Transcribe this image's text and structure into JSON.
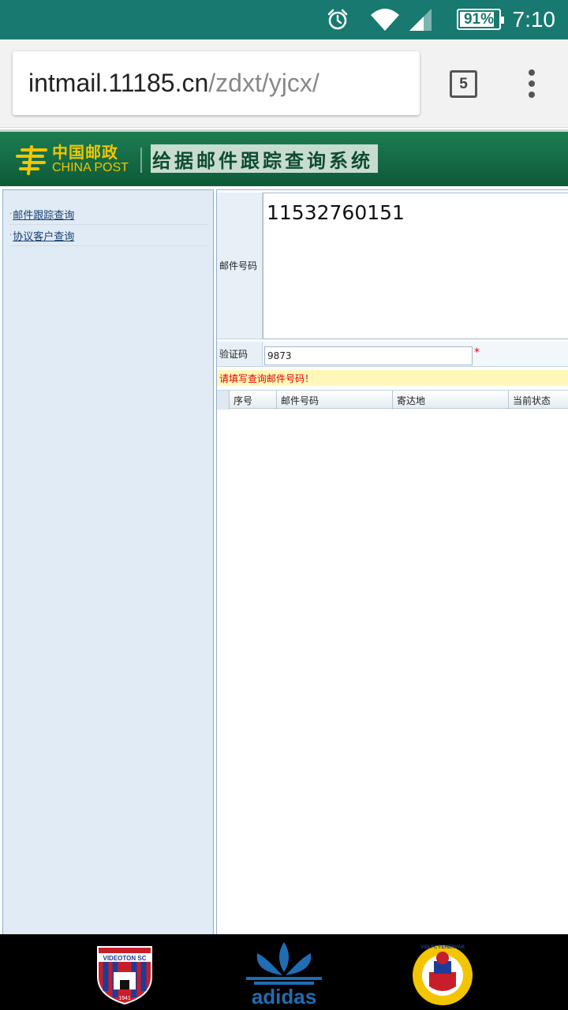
{
  "status_bar": {
    "battery": "91%",
    "battery_level": 0.91,
    "time": "7:10",
    "icons": [
      "alarm-icon",
      "wifi-icon",
      "signal-icon",
      "battery-icon"
    ]
  },
  "browser": {
    "url_host": "intmail.11185.cn",
    "url_path": "/zdxt/yjcx/",
    "tab_count": "5"
  },
  "header": {
    "logo_cn": "中国邮政",
    "logo_en": "CHINA POST",
    "title": "给据邮件跟踪查询系统"
  },
  "sidebar": {
    "items": [
      {
        "label": "邮件跟踪查询"
      },
      {
        "label": "协议客户查询"
      }
    ]
  },
  "form": {
    "number_label": "邮件号码",
    "number_value": "11532760151",
    "captcha_label": "验证码",
    "captcha_value": "9873",
    "required_mark": "*",
    "warning": "请填写查询邮件号码！"
  },
  "results_table": {
    "columns": [
      "序号",
      "邮件号码",
      "寄达地",
      "当前状态"
    ]
  },
  "ad_banner": {
    "left_badge": "VIDEOTON SC",
    "left_badge_year": "1941",
    "brand": "adidas",
    "right_badge": "VIDI FC FEHÉRVÁR"
  },
  "colors": {
    "status_bar": "#17796f",
    "header_green": "#1c7d52",
    "logo_yellow": "#f2c500",
    "sidebar_bg": "#e0ebf5",
    "warning_red": "#e00000",
    "warning_bg": "#fff8b9",
    "adidas_blue": "#1f6db3"
  }
}
